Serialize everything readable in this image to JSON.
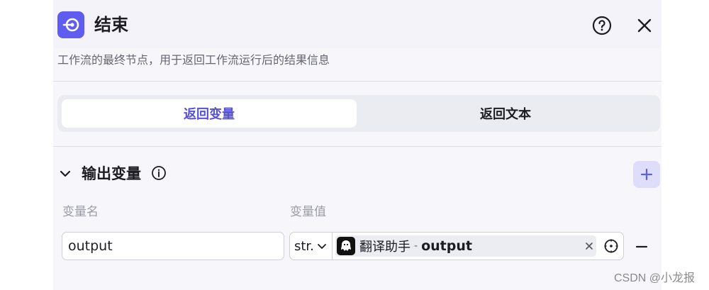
{
  "header": {
    "title": "结束",
    "description": "工作流的最终节点，用于返回工作流运行后的结果信息",
    "icons": {
      "node": "end-node-icon",
      "help": "help-icon",
      "close": "close-icon"
    }
  },
  "tabs": [
    {
      "label": "返回变量",
      "active": true
    },
    {
      "label": "返回文本",
      "active": false
    }
  ],
  "output_section": {
    "title": "输出变量",
    "col_name": "变量名",
    "col_value": "变量值",
    "rows": [
      {
        "name": "output",
        "type": "str.",
        "ref_node": "翻译助手",
        "ref_separator": "-",
        "ref_var": "output"
      }
    ]
  },
  "watermark": "CSDN @小龙报",
  "colors": {
    "accent": "#5f5cf0",
    "active_tab_text": "#5451d6",
    "add_button_bg": "#dedefb"
  }
}
